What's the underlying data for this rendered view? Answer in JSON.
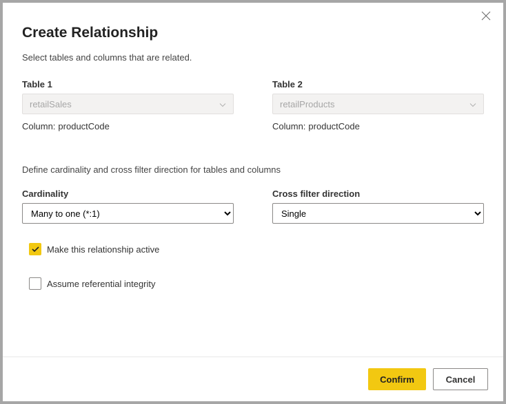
{
  "dialog": {
    "title": "Create Relationship",
    "subtitle": "Select tables and columns that are related.",
    "close_icon": "close"
  },
  "table1": {
    "label": "Table 1",
    "selected": "retailSales",
    "column_label": "Column:",
    "column_value": "productCode"
  },
  "table2": {
    "label": "Table 2",
    "selected": "retailProducts",
    "column_label": "Column:",
    "column_value": "productCode"
  },
  "section2_text": "Define cardinality and cross filter direction for tables and columns",
  "cardinality": {
    "label": "Cardinality",
    "value": "Many to one (*:1)"
  },
  "crossfilter": {
    "label": "Cross filter direction",
    "value": "Single"
  },
  "checkbox_active": {
    "label": "Make this relationship active",
    "checked": true
  },
  "checkbox_referential": {
    "label": "Assume referential integrity",
    "checked": false
  },
  "footer": {
    "confirm": "Confirm",
    "cancel": "Cancel"
  }
}
